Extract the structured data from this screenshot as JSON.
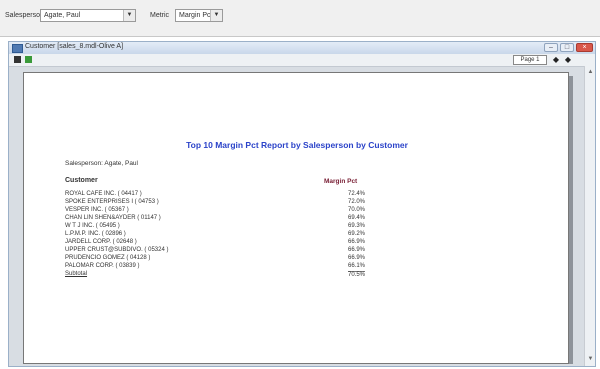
{
  "filters": {
    "salesperson_label": "Salesperson",
    "salesperson_value": "Agate, Paul",
    "metric_label": "Metric",
    "metric_value": "Margin Pct"
  },
  "window": {
    "title": "Customer [sales_8.mdl-Olive A]",
    "page_label": "Page 1"
  },
  "report": {
    "title": "Top 10 Margin Pct Report by Salesperson by Customer",
    "salesperson_line": "Salesperson: Agate, Paul",
    "col_customer": "Customer",
    "col_metric": "Margin Pct",
    "rows": [
      {
        "customer": "ROYAL CAFE INC. ( 04417 )",
        "value": "72.4%"
      },
      {
        "customer": "SPOKE ENTERPRISES I ( 04753 )",
        "value": "72.0%"
      },
      {
        "customer": "VESPER INC. ( 05367 )",
        "value": "70.0%"
      },
      {
        "customer": "CHAN LIN SHEN&AYDER ( 01147 )",
        "value": "69.4%"
      },
      {
        "customer": "W T J INC. ( 05495 )",
        "value": "69.3%"
      },
      {
        "customer": "L.P.M.P. INC. ( 02896 )",
        "value": "69.2%"
      },
      {
        "customer": "JARDELL CORP. ( 02648 )",
        "value": "66.9%"
      },
      {
        "customer": "UPPER CRUST@SUBDIVO. ( 05324 )",
        "value": "66.9%"
      },
      {
        "customer": "PRUDENCIO GOMEZ ( 04128 )",
        "value": "66.9%"
      },
      {
        "customer": "PALOMAR CORP. ( 03839 )",
        "value": "66.1%"
      }
    ],
    "subtotal_label": "Subtotal",
    "subtotal_value": "70.5%"
  }
}
